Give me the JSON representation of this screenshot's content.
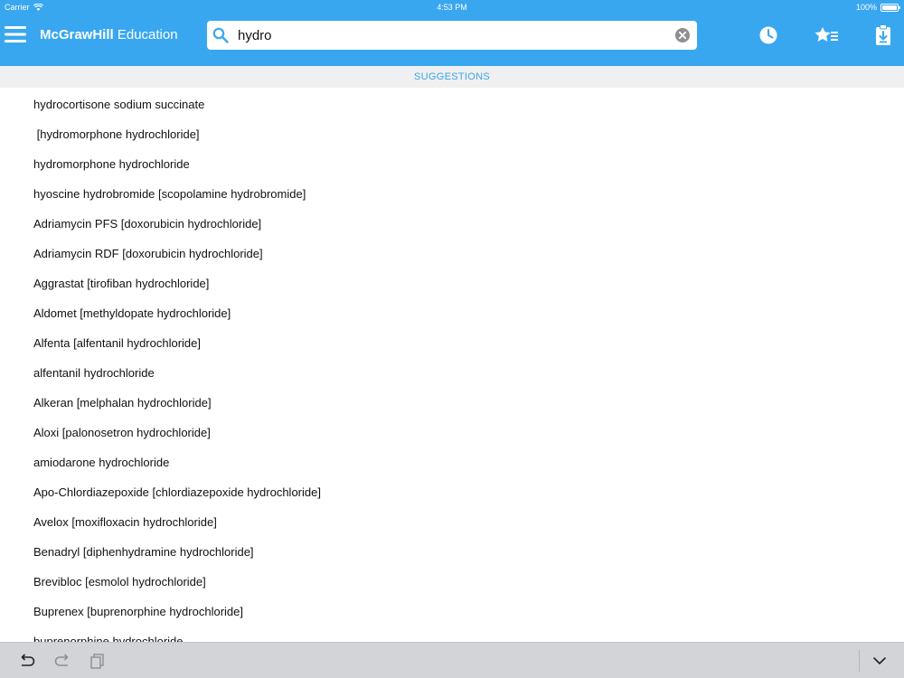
{
  "status_bar": {
    "carrier": "Carrier",
    "time": "4:53 PM",
    "battery": "100%",
    "battery_level": 1.0
  },
  "header": {
    "brand_bold": "McGrawHill",
    "brand_regular": " Education",
    "icons": {
      "menu": "hamburger-icon",
      "history": "clock-icon",
      "favorites": "star-list-icon",
      "downloads": "download-clipboard-icon"
    }
  },
  "search": {
    "value": "hydro",
    "icon": "search-icon",
    "clear_icon": "clear-icon"
  },
  "suggestions": {
    "label": "SUGGESTIONS",
    "items": [
      "hydrocortisone sodium succinate",
      " [hydromorphone hydrochloride]",
      "hydromorphone hydrochloride",
      "hyoscine hydrobromide [scopolamine hydrobromide]",
      "Adriamycin PFS [doxorubicin hydrochloride]",
      "Adriamycin RDF [doxorubicin hydrochloride]",
      "Aggrastat [tirofiban hydrochloride]",
      "Aldomet [methyldopate hydrochloride]",
      "Alfenta [alfentanil hydrochloride]",
      "alfentanil hydrochloride",
      "Alkeran [melphalan hydrochloride]",
      "Aloxi [palonosetron hydrochloride]",
      "amiodarone hydrochloride",
      "Apo-Chlordiazepoxide [chlordiazepoxide hydrochloride]",
      "Avelox [moxifloxacin hydrochloride]",
      "Benadryl [diphenhydramine hydrochloride]",
      "Brevibloc [esmolol hydrochloride]",
      "Buprenex [buprenorphine hydrochloride]",
      "buprenorphine hydrochloride"
    ]
  },
  "keyboard_toolbar": {
    "icons": [
      "undo-icon",
      "redo-icon",
      "paste-icon",
      "dismiss-keyboard-icon"
    ]
  },
  "colors": {
    "accent": "#39a7f0",
    "suggestion_label": "#3aa3e8",
    "toolbar_bg": "#d3d4d8"
  }
}
